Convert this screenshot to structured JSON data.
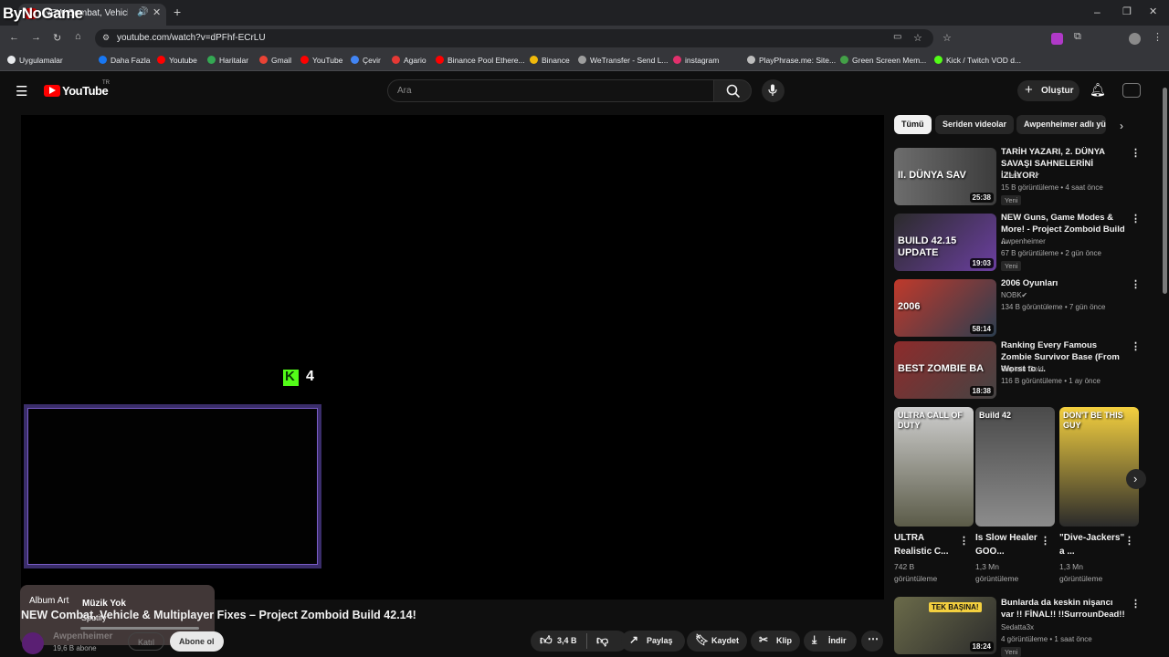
{
  "browser": {
    "tab_title": "NEW Combat, Vehicle & M",
    "url": "youtube.com/watch?v=dPFhf-ECrLU",
    "watermark": "ByNoGame",
    "bookmarks": [
      {
        "label": "Uygulamalar",
        "color": "#e8eaed"
      },
      {
        "label": "Daha Fazla",
        "color": "#1877f2"
      },
      {
        "label": "Youtube",
        "color": "#ff0000"
      },
      {
        "label": "Haritalar",
        "color": "#34a853"
      },
      {
        "label": "Gmail",
        "color": "#ea4335"
      },
      {
        "label": "YouTube",
        "color": "#ff0000"
      },
      {
        "label": "Çevir",
        "color": "#4285f4"
      },
      {
        "label": "Agario",
        "color": "#e53935"
      },
      {
        "label": "Binance Pool Ethere...",
        "color": "#ff0000"
      },
      {
        "label": "Binance",
        "color": "#f0b90b"
      },
      {
        "label": "WeTransfer - Send L...",
        "color": "#9e9e9e"
      },
      {
        "label": "instagram",
        "color": "#e1306c"
      },
      {
        "label": "PlayPhrase.me: Site...",
        "color": "#bdbdbd"
      },
      {
        "label": "Green Screen Mem...",
        "color": "#43a047"
      },
      {
        "label": "Kick / Twitch VOD d...",
        "color": "#53fc18"
      }
    ]
  },
  "header": {
    "logo_text": "YouTube",
    "country": "TR",
    "search_placeholder": "Ara",
    "create_label": "Oluştur"
  },
  "player": {
    "overlay_k_number": "4"
  },
  "chips": [
    "Tümü",
    "Seriden videolar",
    "Awpenheimer adlı yü"
  ],
  "recommended": [
    {
      "title": "TARİH YAZARI, 2. DÜNYA SAVAŞI SAHNELERİNİ İZLİYOR!",
      "channel": "Literat",
      "verified": true,
      "meta": "15 B görüntüleme • 4 saat önce",
      "badge": "Yeni",
      "duration": "25:38",
      "thumb_text": "II. DÜNYA SAV"
    },
    {
      "title": "NEW Guns, Game Modes & More! - Project Zomboid Build ...",
      "channel": "Awpenheimer",
      "verified": false,
      "meta": "67 B görüntüleme • 2 gün önce",
      "badge": "Yeni",
      "duration": "19:03",
      "thumb_text": "BUILD 42.15 UPDATE"
    },
    {
      "title": "2006 Oyunları",
      "channel": "NOBK",
      "verified": true,
      "meta": "134 B görüntüleme • 7 gün önce",
      "badge": "",
      "duration": "58:14",
      "thumb_text": "2006"
    },
    {
      "title": "Ranking Every Famous Zombie Survivor Base (From Worst to ...",
      "channel": "Captain Gold",
      "verified": false,
      "meta": "116 B görüntüleme • 1 ay önce",
      "badge": "",
      "duration": "18:38",
      "thumb_text": "BEST ZOMBIE BA"
    }
  ],
  "shorts": [
    {
      "title": "ULTRA Realistic C...",
      "views": "742 B",
      "label": "görüntüleme",
      "thumb_text": "ULTRA CALL OF DUTY"
    },
    {
      "title": "Is Slow Healer GOO...",
      "views": "1,3 Mn",
      "label": "görüntüleme",
      "thumb_text": "Build 42"
    },
    {
      "title": "\"Dive-Jackers\" a ...",
      "views": "1,3 Mn",
      "label": "görüntüleme",
      "thumb_text": "DON'T BE THIS GUY"
    }
  ],
  "last_rec": {
    "title": "Bunlarda da keskin nişancı var !! FİNAL!! !!SurrounDead!!",
    "channel": "Sedatta3x",
    "meta": "4 görüntüleme • 1 saat önce",
    "badge": "Yeni",
    "duration": "18:24",
    "thumb_text": "TEK BAŞINA!"
  },
  "video": {
    "title": "NEW Combat, Vehicle & Multiplayer Fixes – Project Zomboid Build 42.14!",
    "channel": "Awpenheimer",
    "subscribers": "19,6 B abone",
    "join_label": "Katıl",
    "subscribe_label": "Abone ol",
    "likes": "3,4 B",
    "share_label": "Paylaş",
    "save_label": "Kaydet",
    "clip_label": "Klip",
    "download_label": "İndir"
  },
  "music_card": {
    "art_label": "Album Art",
    "title": "Müzik Yok",
    "source": "Spotify"
  }
}
